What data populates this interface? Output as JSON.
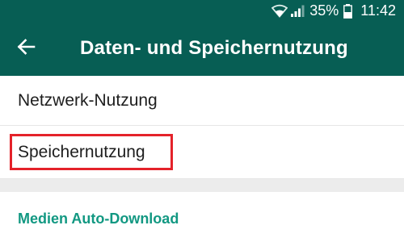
{
  "status_bar": {
    "battery_percent": "35%",
    "time": "11:42",
    "icons": [
      "wifi-icon",
      "signal-icon",
      "battery-icon"
    ]
  },
  "app_bar": {
    "title": "Daten- und Speichernutzung",
    "back_icon": "arrow-left-icon"
  },
  "list": {
    "items": [
      {
        "label": "Netzwerk-Nutzung"
      },
      {
        "label": "Speichernutzung"
      }
    ]
  },
  "section": {
    "header": "Medien Auto-Download"
  },
  "colors": {
    "toolbar": "#075e54",
    "accent": "#129882",
    "highlight": "#e4222a"
  }
}
